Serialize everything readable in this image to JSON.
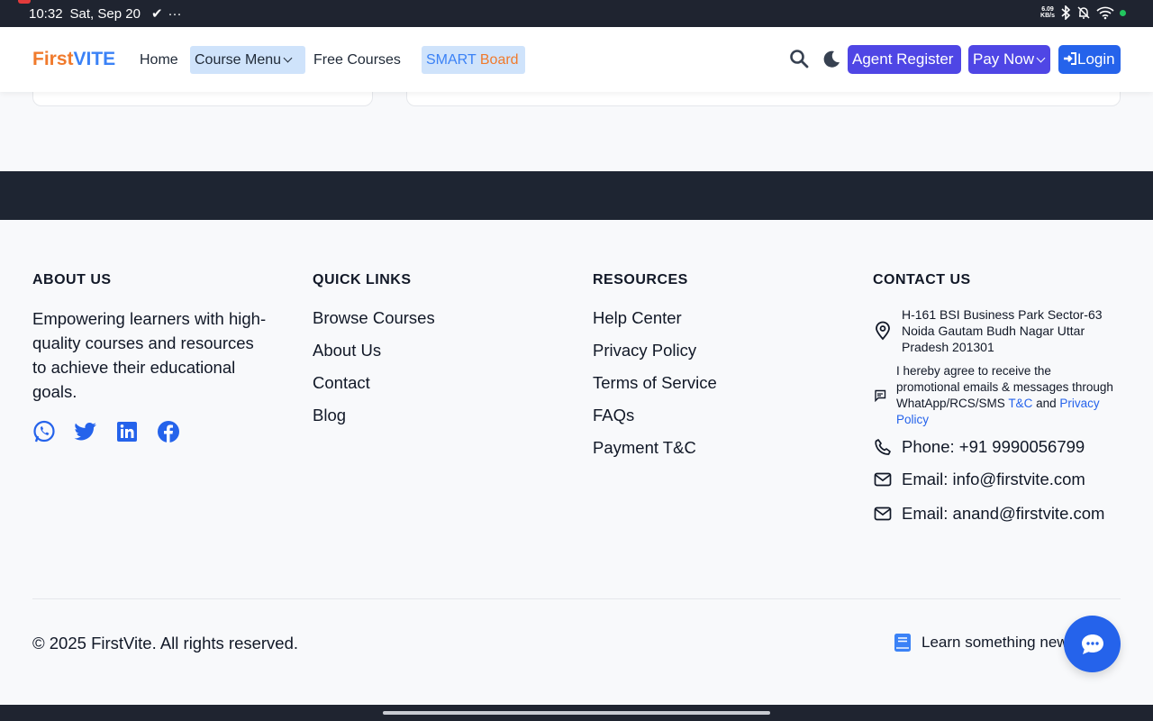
{
  "status_bar": {
    "time": "10:32",
    "date": "Sat, Sep 20",
    "net_speed_value": "6.09",
    "net_speed_unit": "KB/s"
  },
  "navbar": {
    "logo_first": "First",
    "logo_vite": "VITE",
    "home": "Home",
    "course_menu": "Course Menu",
    "free_courses": "Free Courses",
    "smart": "SMART",
    "board": "Board",
    "agent_register": "Agent Register",
    "pay_now": "Pay Now",
    "login": "Login"
  },
  "footer": {
    "about": {
      "title": "ABOUT US",
      "text": "Empowering learners with high-quality courses and resources to achieve their educational goals.",
      "socials": [
        "whatsapp-icon",
        "twitter-icon",
        "linkedin-icon",
        "facebook-icon"
      ]
    },
    "quick_links": {
      "title": "QUICK LINKS",
      "items": [
        "Browse Courses",
        "About Us",
        "Contact",
        "Blog"
      ]
    },
    "resources": {
      "title": "RESOURCES",
      "items": [
        "Help Center",
        "Privacy Policy",
        "Terms of Service",
        "FAQs",
        "Payment T&C"
      ]
    },
    "contact": {
      "title": "CONTACT US",
      "address": "H-161 BSI Business Park Sector-63 Noida Gautam Budh Nagar Uttar Pradesh 201301",
      "consent_text": "I hereby agree to receive the promotional emails & messages through WhatApp/RCS/SMS",
      "consent_tc": "T&C",
      "consent_and": "and",
      "consent_privacy": "Privacy Policy",
      "phone": "Phone: +91 9990056799",
      "email1": "Email: info@firstvite.com",
      "email2": "Email: anand@firstvite.com"
    },
    "copyright": "© 2025 FirstVite. All rights reserved.",
    "learn": "Learn something new"
  },
  "colors": {
    "brand_orange": "#f07a2c",
    "brand_blue": "#3b82f6",
    "button_indigo": "#4f46e5",
    "button_blue": "#2563eb",
    "dark_band": "#1e2532"
  }
}
